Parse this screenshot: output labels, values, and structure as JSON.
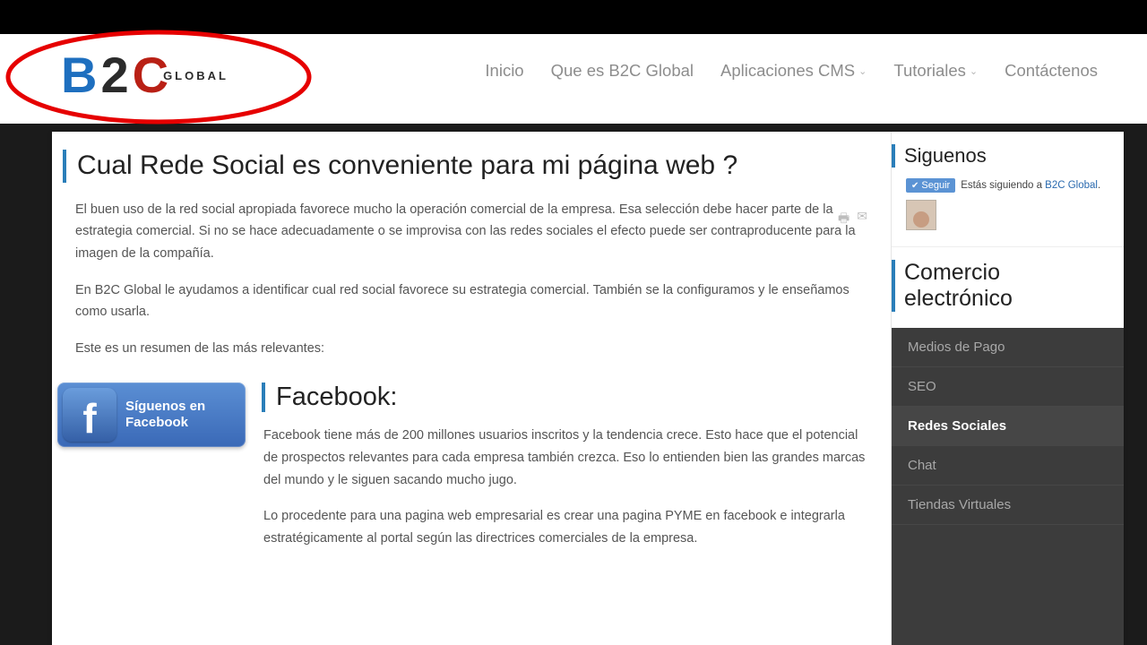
{
  "logo": {
    "b": "B",
    "two": "2",
    "c": "C",
    "global": "GLOBAL"
  },
  "nav": {
    "inicio": "Inicio",
    "quees": "Que es B2C Global",
    "apps": "Aplicaciones CMS",
    "tutoriales": "Tutoriales",
    "contacto": "Contáctenos"
  },
  "article": {
    "title": "Cual Rede Social es conveniente para mi página web ?",
    "p1": "El buen uso de la red social apropiada favorece mucho la operación comercial de la empresa. Esa selección debe hacer parte de la estrategia comercial. Si no se hace adecuadamente o se improvisa con las redes sociales el efecto puede ser contraproducente para la imagen de la compañía.",
    "p2": "En B2C Global le ayudamos a identificar cual red social favorece su estrategia comercial. También se la configuramos y le enseñamos como usarla.",
    "p3": "Este es un resumen de las más relevantes:",
    "fb_badge_line1": "Síguenos en",
    "fb_badge_line2": "Facebook",
    "fb_heading": "Facebook:",
    "fb_p1": "Facebook tiene más de 200 millones usuarios inscritos y la tendencia crece. Esto hace que el potencial de prospectos relevantes para cada empresa también crezca. Eso lo entienden bien las grandes marcas del mundo y le siguen sacando mucho jugo.",
    "fb_p2": "Lo procedente para una pagina web empresarial es crear una pagina PYME en facebook e integrarla estratégicamente al portal según las directrices comerciales de la empresa."
  },
  "sidebar": {
    "siguenos": "Siguenos",
    "seguir": "Seguir",
    "follow_text_pre": "Estás siguiendo a ",
    "follow_link": "B2C Global",
    "commerce": "Comercio electrónico",
    "menu": {
      "medios": "Medios de Pago",
      "seo": "SEO",
      "redes": "Redes Sociales",
      "chat": "Chat",
      "tiendas": "Tiendas Virtuales"
    }
  }
}
